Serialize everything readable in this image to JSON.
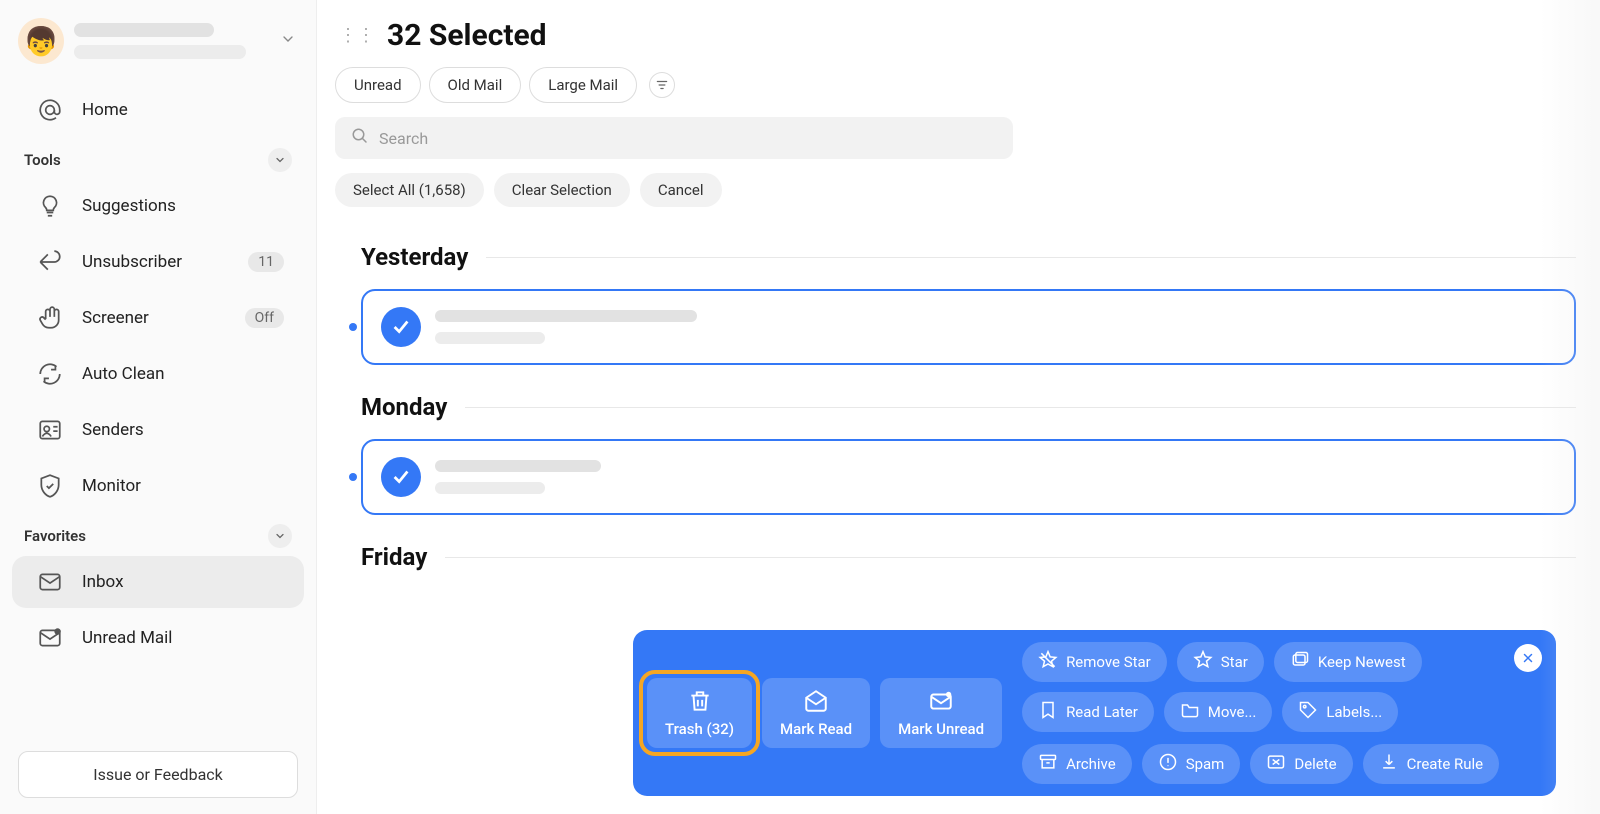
{
  "profile": {
    "avatar_emoji": "👦"
  },
  "sidebar": {
    "home": "Home",
    "tools_section": "Tools",
    "suggestions": "Suggestions",
    "unsubscriber": "Unsubscriber",
    "unsubscriber_badge": "11",
    "screener": "Screener",
    "screener_badge": "Off",
    "auto_clean": "Auto Clean",
    "senders": "Senders",
    "monitor": "Monitor",
    "favorites_section": "Favorites",
    "inbox": "Inbox",
    "unread_mail": "Unread Mail",
    "feedback": "Issue or Feedback"
  },
  "header": {
    "selected_title": "32 Selected",
    "filters": {
      "unread": "Unread",
      "old_mail": "Old Mail",
      "large_mail": "Large Mail"
    },
    "search_placeholder": "Search",
    "select_all": "Select All (1,658)",
    "select_all_count": 1658,
    "clear_selection": "Clear Selection",
    "cancel": "Cancel"
  },
  "days": {
    "yesterday": "Yesterday",
    "monday": "Monday",
    "friday": "Friday"
  },
  "selection_count": 32,
  "action_bar": {
    "trash": "Trash (32)",
    "mark_read": "Mark Read",
    "mark_unread": "Mark Unread",
    "remove_star": "Remove Star",
    "star": "Star",
    "keep_newest": "Keep Newest",
    "read_later": "Read Later",
    "move": "Move...",
    "labels": "Labels...",
    "archive": "Archive",
    "spam": "Spam",
    "delete": "Delete",
    "create_rule": "Create Rule"
  },
  "mail_line_widths": {
    "y1": "262px",
    "m1": "166px"
  }
}
